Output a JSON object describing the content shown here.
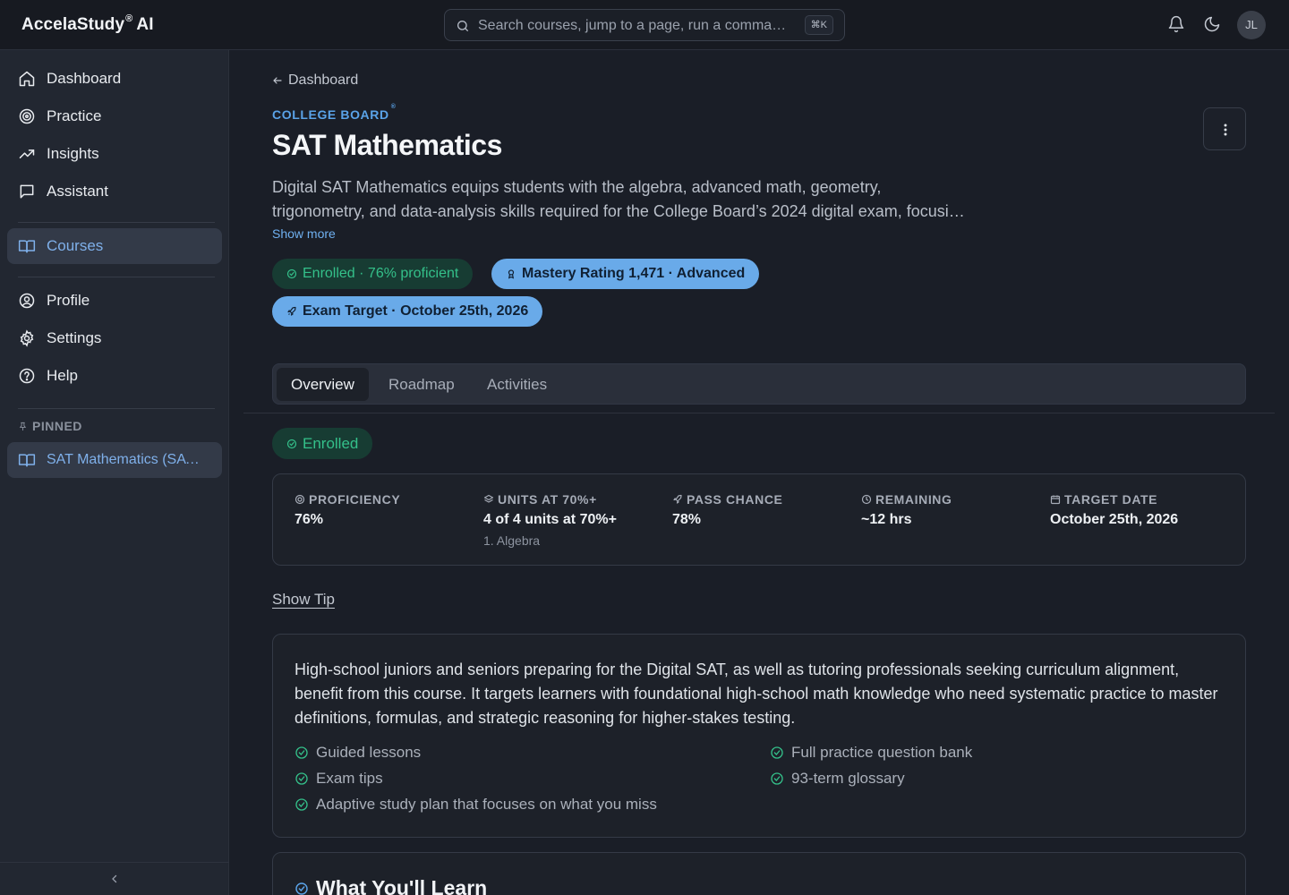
{
  "app": {
    "name": "AccelaStudy",
    "name_sup": "®",
    "name_suffix": "AI"
  },
  "search": {
    "placeholder": "Search courses, jump to a page, run a comma…",
    "shortcut": "⌘K"
  },
  "user": {
    "initials": "JL"
  },
  "sidebar": {
    "items": [
      {
        "label": "Dashboard",
        "icon": "home-icon"
      },
      {
        "label": "Practice",
        "icon": "target-icon"
      },
      {
        "label": "Insights",
        "icon": "trend-up-icon"
      },
      {
        "label": "Assistant",
        "icon": "chat-icon"
      },
      {
        "label": "Courses",
        "icon": "book-icon",
        "active": true
      },
      {
        "label": "Profile",
        "icon": "user-circle-icon"
      },
      {
        "label": "Settings",
        "icon": "gear-icon"
      },
      {
        "label": "Help",
        "icon": "help-icon"
      }
    ],
    "pinned_header": "PINNED",
    "pinned": [
      {
        "label": "SAT Mathematics (SAT…",
        "icon": "book-icon"
      }
    ]
  },
  "course": {
    "back_label": "Dashboard",
    "provider": "COLLEGE BOARD",
    "provider_mark": "®",
    "title": "SAT Mathematics",
    "description": "Digital SAT Mathematics equips students with the algebra, advanced math, geometry, trigonometry, and data-analysis skills required for the College Board’s 2024 digital exam, focusing on the concepts most frequently tested.",
    "show_more": "Show more",
    "pills": {
      "enrolled": "Enrolled · 76% proficient",
      "mastery": "Mastery Rating 1,471 · Advanced",
      "exam": "Exam Target · October 25th, 2026"
    }
  },
  "tabs": [
    {
      "label": "Overview",
      "active": true
    },
    {
      "label": "Roadmap"
    },
    {
      "label": "Activities"
    }
  ],
  "status": "Enrolled",
  "stats": {
    "proficiency": {
      "label": "PROFICIENCY",
      "value": "76%"
    },
    "units": {
      "label": "UNITS AT 70%+",
      "value": "4 of 4 units at 70%+",
      "sub": "1. Algebra"
    },
    "pass": {
      "label": "PASS CHANCE",
      "value": "78%"
    },
    "remaining": {
      "label": "REMAINING",
      "value": "~12 hrs"
    },
    "target": {
      "label": "TARGET DATE",
      "value": "October 25th, 2026"
    }
  },
  "show_tip": "Show Tip",
  "audience": {
    "text": "High-school juniors and seniors preparing for the Digital SAT, as well as tutoring professionals seeking curriculum alignment, benefit from this course. It targets learners with foundational high-school math knowledge who need systematic practice to master definitions, formulas, and strategic reasoning for higher-stakes testing.",
    "features": [
      "Guided lessons",
      "Full practice question bank",
      "Exam tips",
      "93-term glossary",
      "Adaptive study plan that focuses on what you miss"
    ]
  },
  "learn": {
    "title": "What You'll Learn"
  },
  "colors": {
    "accent": "#5aa3e8",
    "success": "#34c08a",
    "pill_blue": "#69aae9"
  }
}
